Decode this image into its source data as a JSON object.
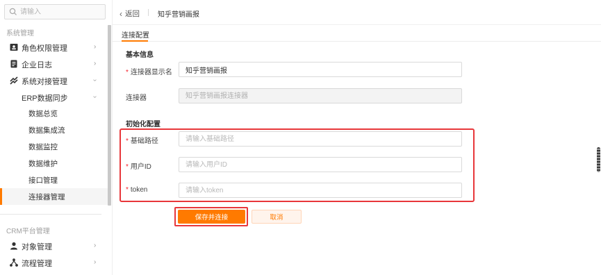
{
  "sidebar": {
    "search_placeholder": "请输入",
    "group1_title": "系统管理",
    "items": [
      {
        "label": "角色权限管理",
        "icon": "id-card-icon"
      },
      {
        "label": "企业日志",
        "icon": "document-icon"
      },
      {
        "label": "系统对接管理",
        "icon": "link-icon"
      }
    ],
    "sub_group": {
      "label": "ERP数据同步"
    },
    "leaves": [
      "数据总览",
      "数据集成流",
      "数据监控",
      "数据维护",
      "接口管理",
      "连接器管理"
    ],
    "active_leaf": "连接器管理",
    "group2_title": "CRM平台管理",
    "items2": [
      {
        "label": "对象管理",
        "icon": "user-icon"
      },
      {
        "label": "流程管理",
        "icon": "flow-icon"
      }
    ]
  },
  "header": {
    "back_label": "返回",
    "title": "知乎营销画报"
  },
  "tabs": [
    {
      "label": "连接配置"
    }
  ],
  "form": {
    "basic_section": "基本信息",
    "display_name_label": "连接器显示名",
    "display_name_value": "知乎营销画报",
    "connector_label": "连接器",
    "connector_placeholder": "知乎营销画报连接器",
    "init_section": "初始化配置",
    "base_path_label": "基础路径",
    "base_path_placeholder": "请输入基础路径",
    "user_id_label": "用户ID",
    "user_id_placeholder": "请输入用户ID",
    "token_label": "token",
    "token_placeholder": "请输入token"
  },
  "actions": {
    "save_label": "保存并连接",
    "cancel_label": "取消"
  },
  "colors": {
    "accent": "#ff7a00",
    "highlight": "#e8363a"
  }
}
